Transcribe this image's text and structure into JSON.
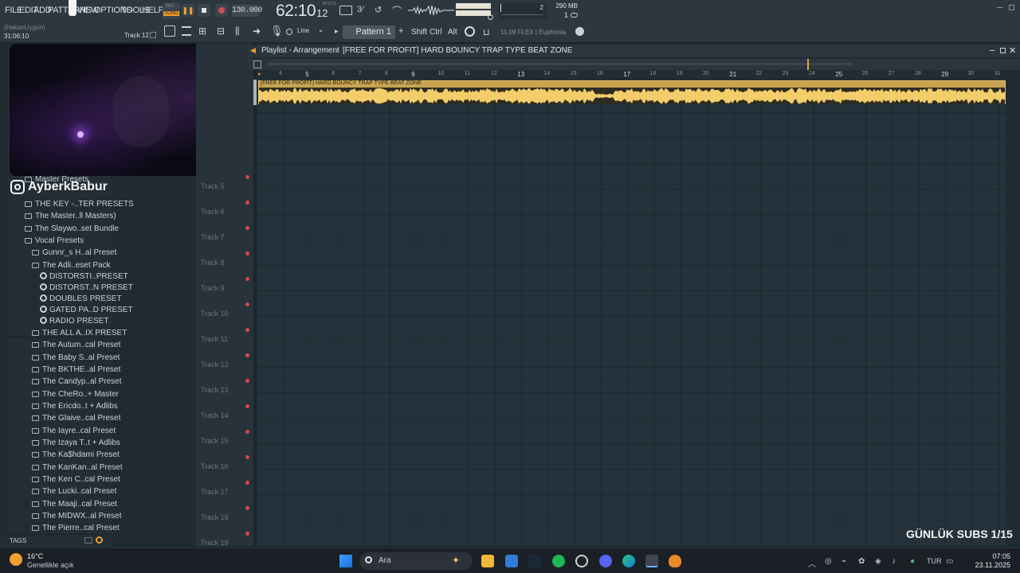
{
  "menu": [
    "FILE",
    "EDIT",
    "ADD",
    "PATTERNS",
    "VIEW",
    "OPTIONS",
    "TOOLS",
    "HELP"
  ],
  "transport": {
    "mode_top": "PAT",
    "mode_bottom": "SONG",
    "tempo": "130.000",
    "time_main": "62:10",
    "time_sub": "12",
    "time_tiny": "M:S:CS",
    "cpu_value": "2",
    "memory": "290 MB",
    "voices": "1"
  },
  "hint_bar": {
    "user": "(HakanUygun)",
    "time": "31:06:10",
    "track_label": "Track 12"
  },
  "toolbar2": {
    "snap": "Line",
    "pattern": "Pattern 1",
    "shift": "Shift",
    "ctrl": "Ctrl",
    "alt": "Alt",
    "news": "11.09  FLEX | Euphonia"
  },
  "playlist": {
    "title": "Playlist - Arrangement",
    "arrangement": "[FREE FOR PROFIT] HARD BOUNCY TRAP TYPE BEAT ZONE",
    "clip_name": "[FREE FOR PROFIT] HARD BOUNCY TRAP TYPE BEAT ZONE",
    "ruler": [
      "4",
      "5",
      "6",
      "7",
      "8",
      "9",
      "10",
      "11",
      "12",
      "13",
      "14",
      "15",
      "16",
      "17",
      "18",
      "19",
      "20",
      "21",
      "22",
      "23",
      "24",
      "25",
      "26",
      "27",
      "28",
      "29",
      "30",
      "31"
    ]
  },
  "tracks": [
    "Track 5",
    "Track 6",
    "Track 7",
    "Track 8",
    "Track 9",
    "Track 10",
    "Track 11",
    "Track 12",
    "Track 13",
    "Track 14",
    "Track 15",
    "Track 16",
    "Track 17",
    "Track 18",
    "Track 19"
  ],
  "overlay": {
    "handle": "AyberkBabur",
    "subs": "GÜNLÜK SUBS 1/15"
  },
  "browser": {
    "items": [
      {
        "label": "Master Presets",
        "type": "folder",
        "indent": 1
      },
      {
        "label": "THE KEY -..TER PRESETS",
        "type": "folder",
        "indent": 1
      },
      {
        "label": "The Master..ll Masters)",
        "type": "folder",
        "indent": 1
      },
      {
        "label": "The Slaywo..set Bundle",
        "type": "folder",
        "indent": 1
      },
      {
        "label": "Vocal Presets",
        "type": "folder",
        "indent": 1
      },
      {
        "label": "Gunnr_s H..al Preset",
        "type": "folder",
        "indent": 2
      },
      {
        "label": "The Adli..eset Pack",
        "type": "folder",
        "indent": 2
      },
      {
        "label": "DISTORSTI..PRESET",
        "type": "preset",
        "indent": 3
      },
      {
        "label": "DISTORST..N PRESET",
        "type": "preset",
        "indent": 3
      },
      {
        "label": "DOUBLES PRESET",
        "type": "preset",
        "indent": 3
      },
      {
        "label": "GATED PA..D PRESET",
        "type": "preset",
        "indent": 3
      },
      {
        "label": "RADIO PRESET",
        "type": "preset",
        "indent": 3
      },
      {
        "label": "THE ALL A..IX PRESET",
        "type": "folder",
        "indent": 2
      },
      {
        "label": "The Autum..cal Preset",
        "type": "folder",
        "indent": 2
      },
      {
        "label": "The Baby S..al Preset",
        "type": "folder",
        "indent": 2
      },
      {
        "label": "The BKTHE..al Preset",
        "type": "folder",
        "indent": 2
      },
      {
        "label": "The Candyp..al Preset",
        "type": "folder",
        "indent": 2
      },
      {
        "label": "The CheRo..+ Master",
        "type": "folder",
        "indent": 2
      },
      {
        "label": "The Ericdo..t + Adlibs",
        "type": "folder",
        "indent": 2
      },
      {
        "label": "The Glaive..cal Preset",
        "type": "folder",
        "indent": 2
      },
      {
        "label": "The Iayre..cal Preset",
        "type": "folder",
        "indent": 2
      },
      {
        "label": "The Izaya T..t + Adlibs",
        "type": "folder",
        "indent": 2
      },
      {
        "label": "The Ka$hdami Preset",
        "type": "folder",
        "indent": 2
      },
      {
        "label": "The KanKan..al Preset",
        "type": "folder",
        "indent": 2
      },
      {
        "label": "The Ken C..cal Preset",
        "type": "folder",
        "indent": 2
      },
      {
        "label": "The Lucki..cal Preset",
        "type": "folder",
        "indent": 2
      },
      {
        "label": "The Maaji..cal Preset",
        "type": "folder",
        "indent": 2
      },
      {
        "label": "The MIDWX..al Preset",
        "type": "folder",
        "indent": 2
      },
      {
        "label": "The Pierre..cal Preset",
        "type": "folder",
        "indent": 2
      }
    ],
    "tags_label": "TAGS"
  },
  "taskbar": {
    "weather_temp": "16°C",
    "weather_desc": "Genellikle açık",
    "search_placeholder": "Ara",
    "lang": "TUR",
    "time": "07:05",
    "date": "23.11.2025"
  },
  "colors": {
    "clip": "#e6c266",
    "accent": "#f0a030",
    "record": "#d24a52"
  }
}
